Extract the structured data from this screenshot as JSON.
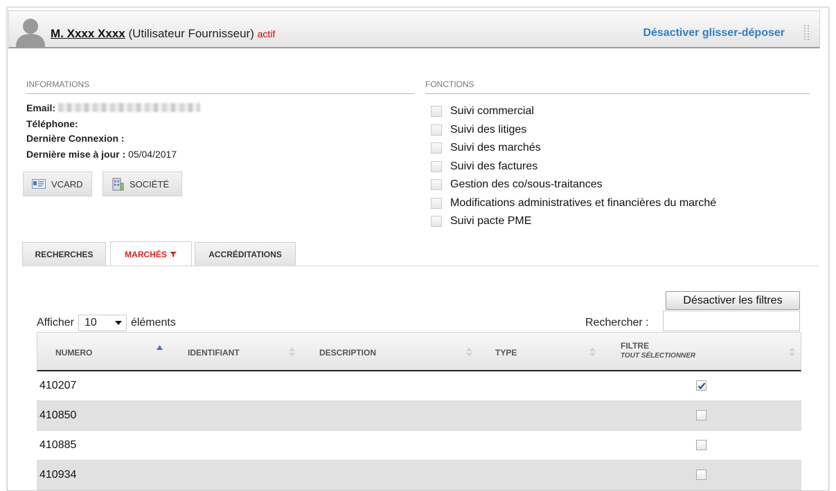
{
  "header": {
    "user_name": "M. Xxxx Xxxx",
    "user_role": "(Utilisateur Fournisseur)",
    "user_status": "actif",
    "dnd_link": "Désactiver glisser-déposer"
  },
  "info": {
    "title": "INFORMATIONS",
    "email_label": "Email: ",
    "phone_label": "Téléphone:",
    "last_login_label": "Dernière Connexion :",
    "last_update_label": "Dernière mise à jour : ",
    "last_update_value": "05/04/2017",
    "vcard_button": "VCARD",
    "company_button": "SOCIÉTÉ"
  },
  "functions": {
    "title": "FONCTIONS",
    "items": [
      "Suivi commercial",
      "Suivi des litiges",
      "Suivi des marchés",
      "Suivi des factures",
      "Gestion des co/sous-traitances",
      "Modifications administratives et financières du marché",
      "Suivi pacte PME"
    ]
  },
  "tabs": {
    "searches": "RECHERCHES",
    "markets": "MARCHÉS",
    "accreditations": "ACCRÉDITATIONS"
  },
  "table_controls": {
    "disable_filters": "Désactiver les filtres",
    "show_prefix": "Afficher",
    "show_value": "10",
    "show_suffix": "éléments",
    "search_label": "Rechercher :",
    "search_value": ""
  },
  "table": {
    "columns": {
      "numero": "NUMERO",
      "identifiant": "IDENTIFIANT",
      "description": "DESCRIPTION",
      "type": "TYPE",
      "filtre": "FILTRE",
      "select_all": "TOUT SÉLECTIONNER"
    },
    "rows": [
      {
        "numero": "410207",
        "checked": true
      },
      {
        "numero": "410850",
        "checked": false
      },
      {
        "numero": "410885",
        "checked": false
      },
      {
        "numero": "410934",
        "checked": false
      }
    ]
  },
  "colors": {
    "link_blue": "#2f7fc7",
    "active_red": "#e41d1d",
    "status_red": "#d40000"
  }
}
